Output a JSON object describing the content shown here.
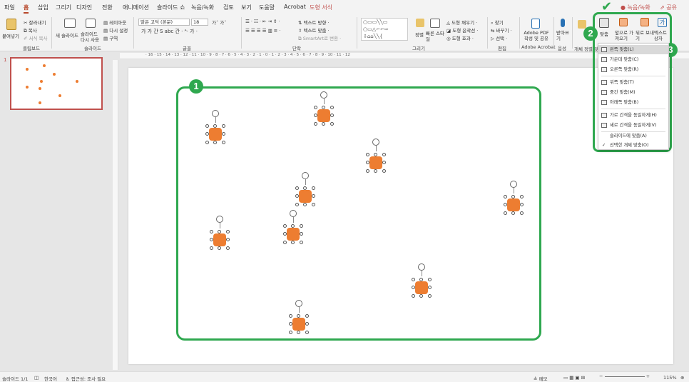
{
  "menu": {
    "items": [
      "파일",
      "홈",
      "삽입",
      "그리기",
      "디자인",
      "전환",
      "애니메이션",
      "슬라이드 쇼",
      "녹음/녹화",
      "검토",
      "보기",
      "도움말",
      "Acrobat",
      "도형 서식"
    ],
    "active": "홈",
    "record_label": "녹음/녹화",
    "share_label": "공유"
  },
  "ribbon": {
    "clipboard": {
      "paste": "붙여넣기",
      "cut": "잘라내기",
      "copy": "복사",
      "format": "서식 복사",
      "group": "클립보드"
    },
    "slides": {
      "new_slide": "새 슬라이드",
      "reuse": "슬라이드 다시 사용",
      "layout": "레이아웃",
      "reset": "다시 설정",
      "section": "구역",
      "group": "슬라이드"
    },
    "font": {
      "name": "맑은 고딕 (본문)",
      "size": "18",
      "group": "글꼴"
    },
    "paragraph": {
      "text_dir": "텍스트 방향",
      "align_text": "텍스트 맞춤",
      "smartart": "SmartArt로 변환",
      "group": "단락"
    },
    "drawing": {
      "arrange": "정렬",
      "quick_styles": "빠른 스타일",
      "fill": "도형 채우기",
      "outline": "도형 윤곽선",
      "effects": "도형 효과",
      "group": "그리기"
    },
    "editing": {
      "find": "찾기",
      "replace": "바꾸기",
      "select": "선택",
      "group": "편집"
    },
    "acrobat": {
      "create": "Adobe PDF 작성 및 공유",
      "group": "Adobe Acrobat"
    },
    "voice": {
      "dictate": "받아쓰기",
      "group": "음성"
    },
    "align_group": {
      "align": "맞춤",
      "bring_forward": "앞으로 가져오기",
      "send_backward": "뒤로 보내기",
      "textbox": "텍스트 상자",
      "header": "개체 정렬 맞"
    }
  },
  "ruler_text": "· 16 · 15 · 14 · 13 · 12 · 11 · 10 · 9 · 8 · 7 · 6 · 5 · 4 · 3 · 2 · 1 · 0 · 1 · 2 · 3 · 4 · 5 · 6 · 7 · 8 · 9 · 10 · 11 · 12",
  "thumbnail": {
    "number": "1"
  },
  "dropdown": {
    "items": [
      {
        "label": "왼쪽 맞춤(L)",
        "checked": false,
        "highlight": true
      },
      {
        "label": "가운데 맞춤(C)",
        "checked": false,
        "highlight": false
      },
      {
        "label": "오른쪽 맞춤(R)",
        "checked": false,
        "highlight": false
      },
      {
        "label": "위쪽 맞춤(T)",
        "checked": false,
        "highlight": false
      },
      {
        "label": "중간 맞춤(M)",
        "checked": false,
        "highlight": false
      },
      {
        "label": "아래쪽 맞춤(B)",
        "checked": false,
        "highlight": false
      },
      {
        "label": "가로 간격을 동일하게(H)",
        "checked": false,
        "highlight": false
      },
      {
        "label": "세로 간격을 동일하게(V)",
        "checked": false,
        "highlight": false
      },
      {
        "label": "슬라이드에 맞춤(A)",
        "checked": false,
        "highlight": false
      },
      {
        "label": "선택한 개체 맞춤(O)",
        "checked": true,
        "highlight": false
      }
    ]
  },
  "badges": {
    "b1": "1",
    "b2": "2",
    "b3": "3"
  },
  "status": {
    "slide": "슬라이드 1/1",
    "lang": "한국어",
    "access": "접근성: 조사 필요",
    "notes": "메모",
    "zoom": "115%"
  },
  "colors": {
    "accent": "#b7472a",
    "shape_fill": "#ed7d31",
    "annotation": "#2fa84f"
  }
}
